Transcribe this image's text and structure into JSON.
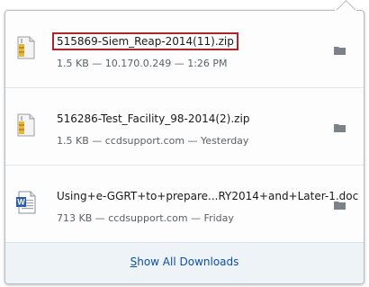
{
  "downloads": [
    {
      "icon": "zip-archive-icon",
      "name": "515869-Siem_Reap-2014(11).zip",
      "meta": "1.5 KB — 10.170.0.249 — 1:26 PM",
      "highlighted": true
    },
    {
      "icon": "zip-archive-icon",
      "name": "516286-Test_Facility_98-2014(2).zip",
      "meta": "1.5 KB — ccdsupport.com — Yesterday",
      "highlighted": false
    },
    {
      "icon": "word-document-icon",
      "name": "Using+e-GGRT+to+prepare...RY2014+and+Later-1.doc",
      "meta": "713 KB — ccdsupport.com — Friday",
      "highlighted": false
    }
  ],
  "footer": {
    "show_all_first_letter": "S",
    "show_all_rest": "how All Downloads"
  },
  "colors": {
    "highlight_border": "#b3242a",
    "link": "#0d4fa5",
    "footer_bg": "#eef3f8"
  }
}
